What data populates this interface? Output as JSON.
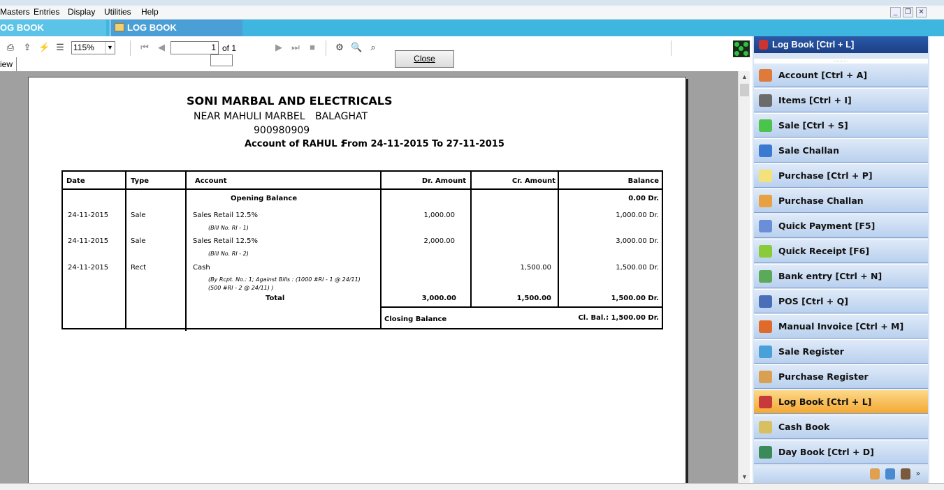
{
  "menu": {
    "items": [
      "Masters",
      "Entries",
      "Display",
      "Utilities",
      "Help"
    ]
  },
  "tabs": [
    "OG BOOK",
    "LOG BOOK"
  ],
  "toolbar": {
    "zoom": "115%",
    "page_current": "1",
    "page_of": "of 1",
    "close_label": "Close",
    "view_tab": "iew"
  },
  "report": {
    "company": "SONI MARBAL AND ELECTRICALS",
    "address": "NEAR MAHULI MARBEL",
    "city": "BALAGHAT",
    "phone": "900980909",
    "account_line": "Account of RAHUL :",
    "period": "From 24-11-2015 To 27-11-2015",
    "headers": [
      "Date",
      "Type",
      "Account",
      "Dr. Amount",
      "Cr. Amount",
      "Balance"
    ],
    "opening_label": "Opening Balance",
    "opening_balance": "0.00 Dr.",
    "rows": [
      {
        "date": "24-11-2015",
        "type": "Sale",
        "account": "Sales Retail 12.5%",
        "note": "(Bill No. RI - 1)",
        "note2": "",
        "dr": "1,000.00",
        "cr": "",
        "balance": "1,000.00 Dr."
      },
      {
        "date": "24-11-2015",
        "type": "Sale",
        "account": "Sales Retail 12.5%",
        "note": "(Bill No. RI - 2)",
        "note2": "",
        "dr": "2,000.00",
        "cr": "",
        "balance": "3,000.00 Dr."
      },
      {
        "date": "24-11-2015",
        "type": "Rect",
        "account": "Cash",
        "note": "(By Rcpt. No.: 1;  Against Bills : (1000 #RI - 1 @ 24/11)",
        "note2": "(500 #RI - 2 @ 24/11) )",
        "dr": "",
        "cr": "1,500.00",
        "balance": "1,500.00 Dr."
      }
    ],
    "total_label": "Total",
    "total_dr": "3,000.00",
    "total_cr": "1,500.00",
    "total_balance": "1,500.00 Dr.",
    "closing_label": "Closing Balance",
    "closing_value": "Cl. Bal.: 1,500.00 Dr."
  },
  "sidebar": {
    "header": "Log Book [Ctrl + L]",
    "items": [
      {
        "label": "Account [Ctrl + A]",
        "icon": "account-icon",
        "color": "#e07a3a"
      },
      {
        "label": "Items [Ctrl + I]",
        "icon": "items-icon",
        "color": "#6b6b6b"
      },
      {
        "label": "Sale [Ctrl + S]",
        "icon": "sale-icon",
        "color": "#4cc34a"
      },
      {
        "label": "Sale Challan",
        "icon": "sale-challan-icon",
        "color": "#3a7ad0"
      },
      {
        "label": "Purchase [Ctrl + P]",
        "icon": "purchase-icon",
        "color": "#f3e27a"
      },
      {
        "label": "Purchase Challan",
        "icon": "purchase-challan-icon",
        "color": "#e8a040"
      },
      {
        "label": "Quick Payment [F5]",
        "icon": "quick-payment-icon",
        "color": "#6a8fd8"
      },
      {
        "label": "Quick Receipt [F6]",
        "icon": "quick-receipt-icon",
        "color": "#8acb3a"
      },
      {
        "label": "Bank entry [Ctrl + N]",
        "icon": "bank-entry-icon",
        "color": "#5aaa5a"
      },
      {
        "label": "POS [Ctrl + Q]",
        "icon": "pos-icon",
        "color": "#4a6fb8"
      },
      {
        "label": "Manual Invoice [Ctrl + M]",
        "icon": "manual-invoice-icon",
        "color": "#e06a2a"
      },
      {
        "label": "Sale Register",
        "icon": "sale-register-icon",
        "color": "#4aa0d8"
      },
      {
        "label": "Purchase Register",
        "icon": "purchase-register-icon",
        "color": "#d8a050"
      },
      {
        "label": "Log Book [Ctrl + L]",
        "icon": "log-book-icon",
        "color": "#c83a3a",
        "active": true
      },
      {
        "label": "Cash Book",
        "icon": "cash-book-icon",
        "color": "#d8c060"
      },
      {
        "label": "Day Book [Ctrl + D]",
        "icon": "day-book-icon",
        "color": "#3a8a5a"
      }
    ]
  }
}
